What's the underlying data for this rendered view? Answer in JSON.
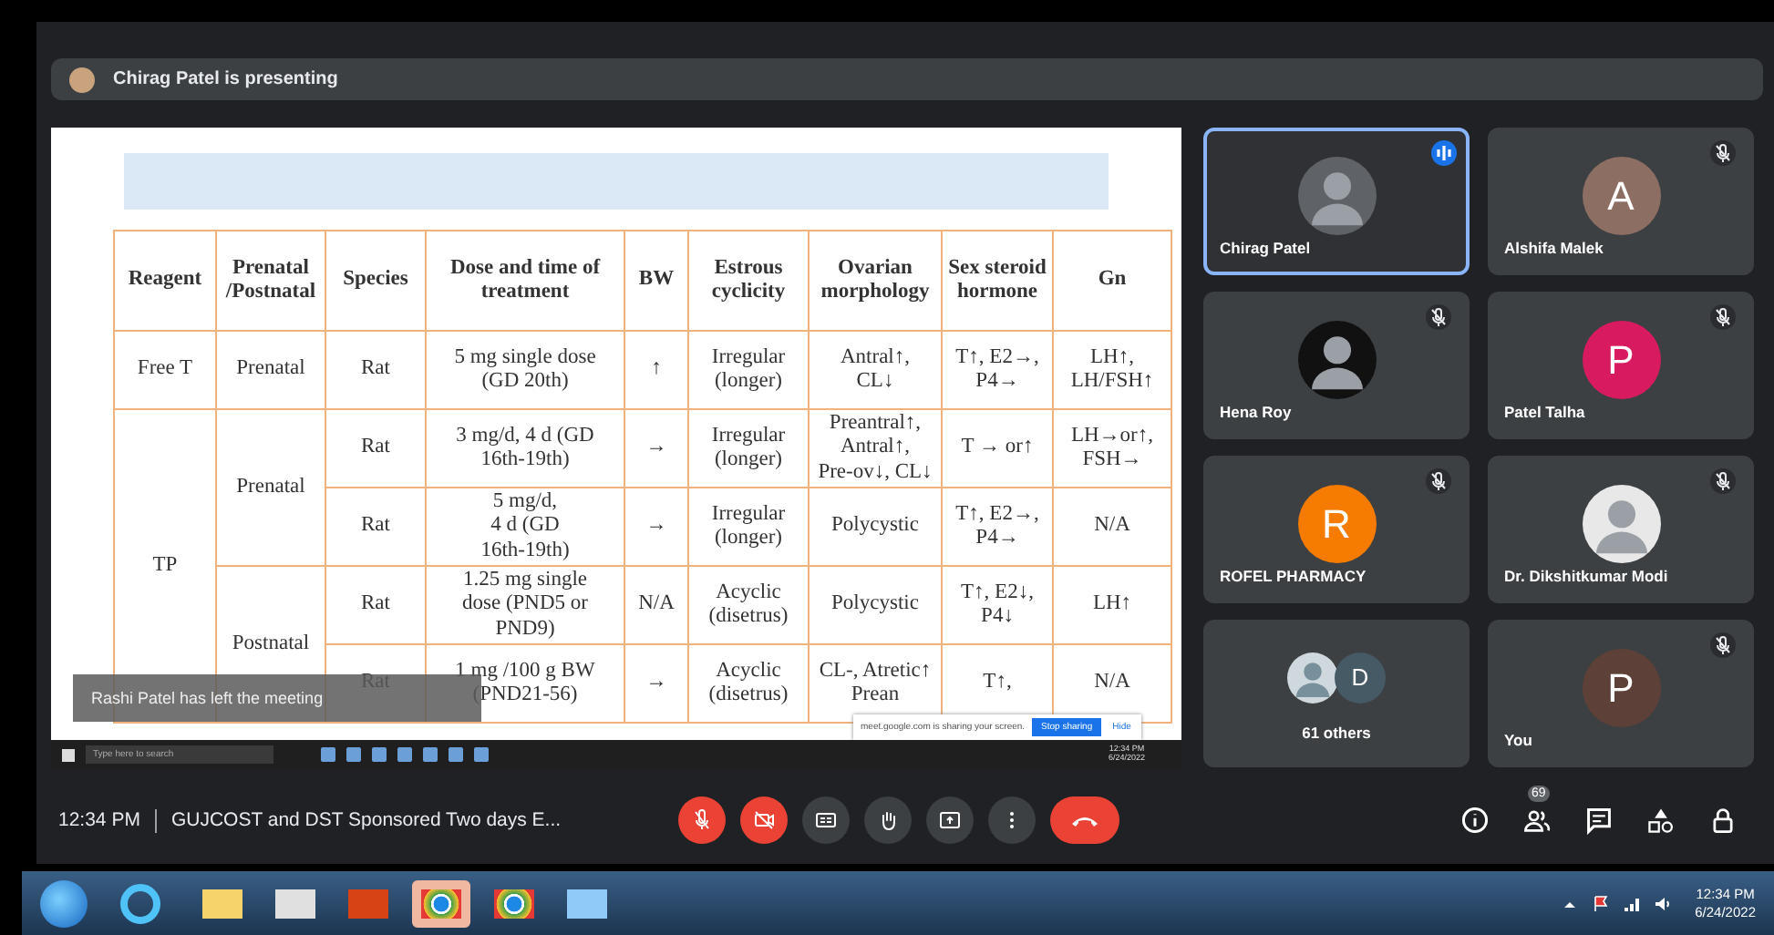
{
  "presenting_bar": {
    "text": "Chirag Patel is presenting"
  },
  "slide": {
    "table": {
      "columns": [
        "Reagent",
        "Prenatal /Postnatal",
        "Species",
        "Dose and time of treatment",
        "BW",
        "Estrous cyclicity",
        "Ovarian morphology",
        "Sex steroid hormone",
        "Gn"
      ],
      "groups": [
        {
          "reagent": "Free T",
          "stages": [
            {
              "stage": "Prenatal",
              "rows": [
                [
                  "Rat",
                  "5 mg single dose\n(GD 20th)",
                  "↑",
                  "Irregular\n(longer)",
                  "Antral↑,\nCL↓",
                  "T↑, E2→,\nP4→",
                  "LH↑,\nLH/FSH↑"
                ]
              ]
            }
          ]
        },
        {
          "reagent": "TP",
          "stages": [
            {
              "stage": "Prenatal",
              "rows": [
                [
                  "Rat",
                  "3 mg/d, 4 d (GD\n16th-19th)",
                  "→",
                  "Irregular\n(longer)",
                  "Preantral↑,\nAntral↑,\nPre-ov↓, CL↓",
                  "T → or↑",
                  "LH→or↑,\nFSH→"
                ],
                [
                  "Rat",
                  "5 mg/d,\n4 d (GD\n16th-19th)",
                  "→",
                  "Irregular\n(longer)",
                  "Polycystic",
                  "T↑, E2→,\nP4→",
                  "N/A"
                ]
              ]
            },
            {
              "stage": "Postnatal",
              "rows": [
                [
                  "Rat",
                  "1.25 mg single\ndose (PND5 or\nPND9)",
                  "N/A",
                  "Acyclic\n(disetrus)",
                  "Polycystic",
                  "T↑, E2↓,\nP4↓",
                  "LH↑"
                ],
                [
                  "Rat",
                  "1 mg /100 g BW\n(PND21-56)",
                  "→",
                  "Acyclic\n(disetrus)",
                  "CL-, Atretic↑\nPrean",
                  "T↑,",
                  "N/A"
                ]
              ]
            }
          ]
        }
      ]
    },
    "toast": "Rashi Patel has left the meeting",
    "share_bar": {
      "text": "meet.google.com is sharing your screen.",
      "stop_button": "Stop sharing",
      "hide_button": "Hide"
    },
    "inner_taskbar": {
      "search_placeholder": "Type here to search",
      "time": "12:34 PM",
      "date": "6/24/2022"
    }
  },
  "tiles": [
    {
      "name": "Chirag Patel",
      "avatar": {
        "kind": "photo",
        "color": "#5f6368"
      },
      "muted": false,
      "speaking": true
    },
    {
      "name": "Alshifa Malek",
      "avatar": {
        "kind": "initial",
        "letter": "A",
        "color": "#8d6e63"
      },
      "muted": true,
      "speaking": false
    },
    {
      "name": "Hena Roy",
      "avatar": {
        "kind": "photo",
        "color": "#111111"
      },
      "muted": true,
      "speaking": false
    },
    {
      "name": "Patel Talha",
      "avatar": {
        "kind": "initial",
        "letter": "P",
        "color": "#d81b60"
      },
      "muted": true,
      "speaking": false
    },
    {
      "name": "ROFEL PHARMACY",
      "avatar": {
        "kind": "initial",
        "letter": "R",
        "color": "#f57c00"
      },
      "muted": true,
      "speaking": false
    },
    {
      "name": "Dr. Dikshitkumar Modi",
      "avatar": {
        "kind": "photo",
        "color": "#e8e8e8"
      },
      "muted": true,
      "speaking": false
    },
    {
      "name": "61 others",
      "avatar": {
        "kind": "group",
        "letter": "D",
        "color": "#455a64"
      },
      "muted": false,
      "speaking": false
    },
    {
      "name": "You",
      "avatar": {
        "kind": "initial",
        "letter": "P",
        "color": "#5d4037"
      },
      "muted": true,
      "speaking": false
    }
  ],
  "bottom_bar": {
    "time": "12:34 PM",
    "meeting_title": "GUJCOST and DST Sponsored Two days E...",
    "mic_on": false,
    "camera_on": false,
    "people_count": "69"
  },
  "taskbar": {
    "time": "12:34 PM",
    "date": "6/24/2022"
  }
}
